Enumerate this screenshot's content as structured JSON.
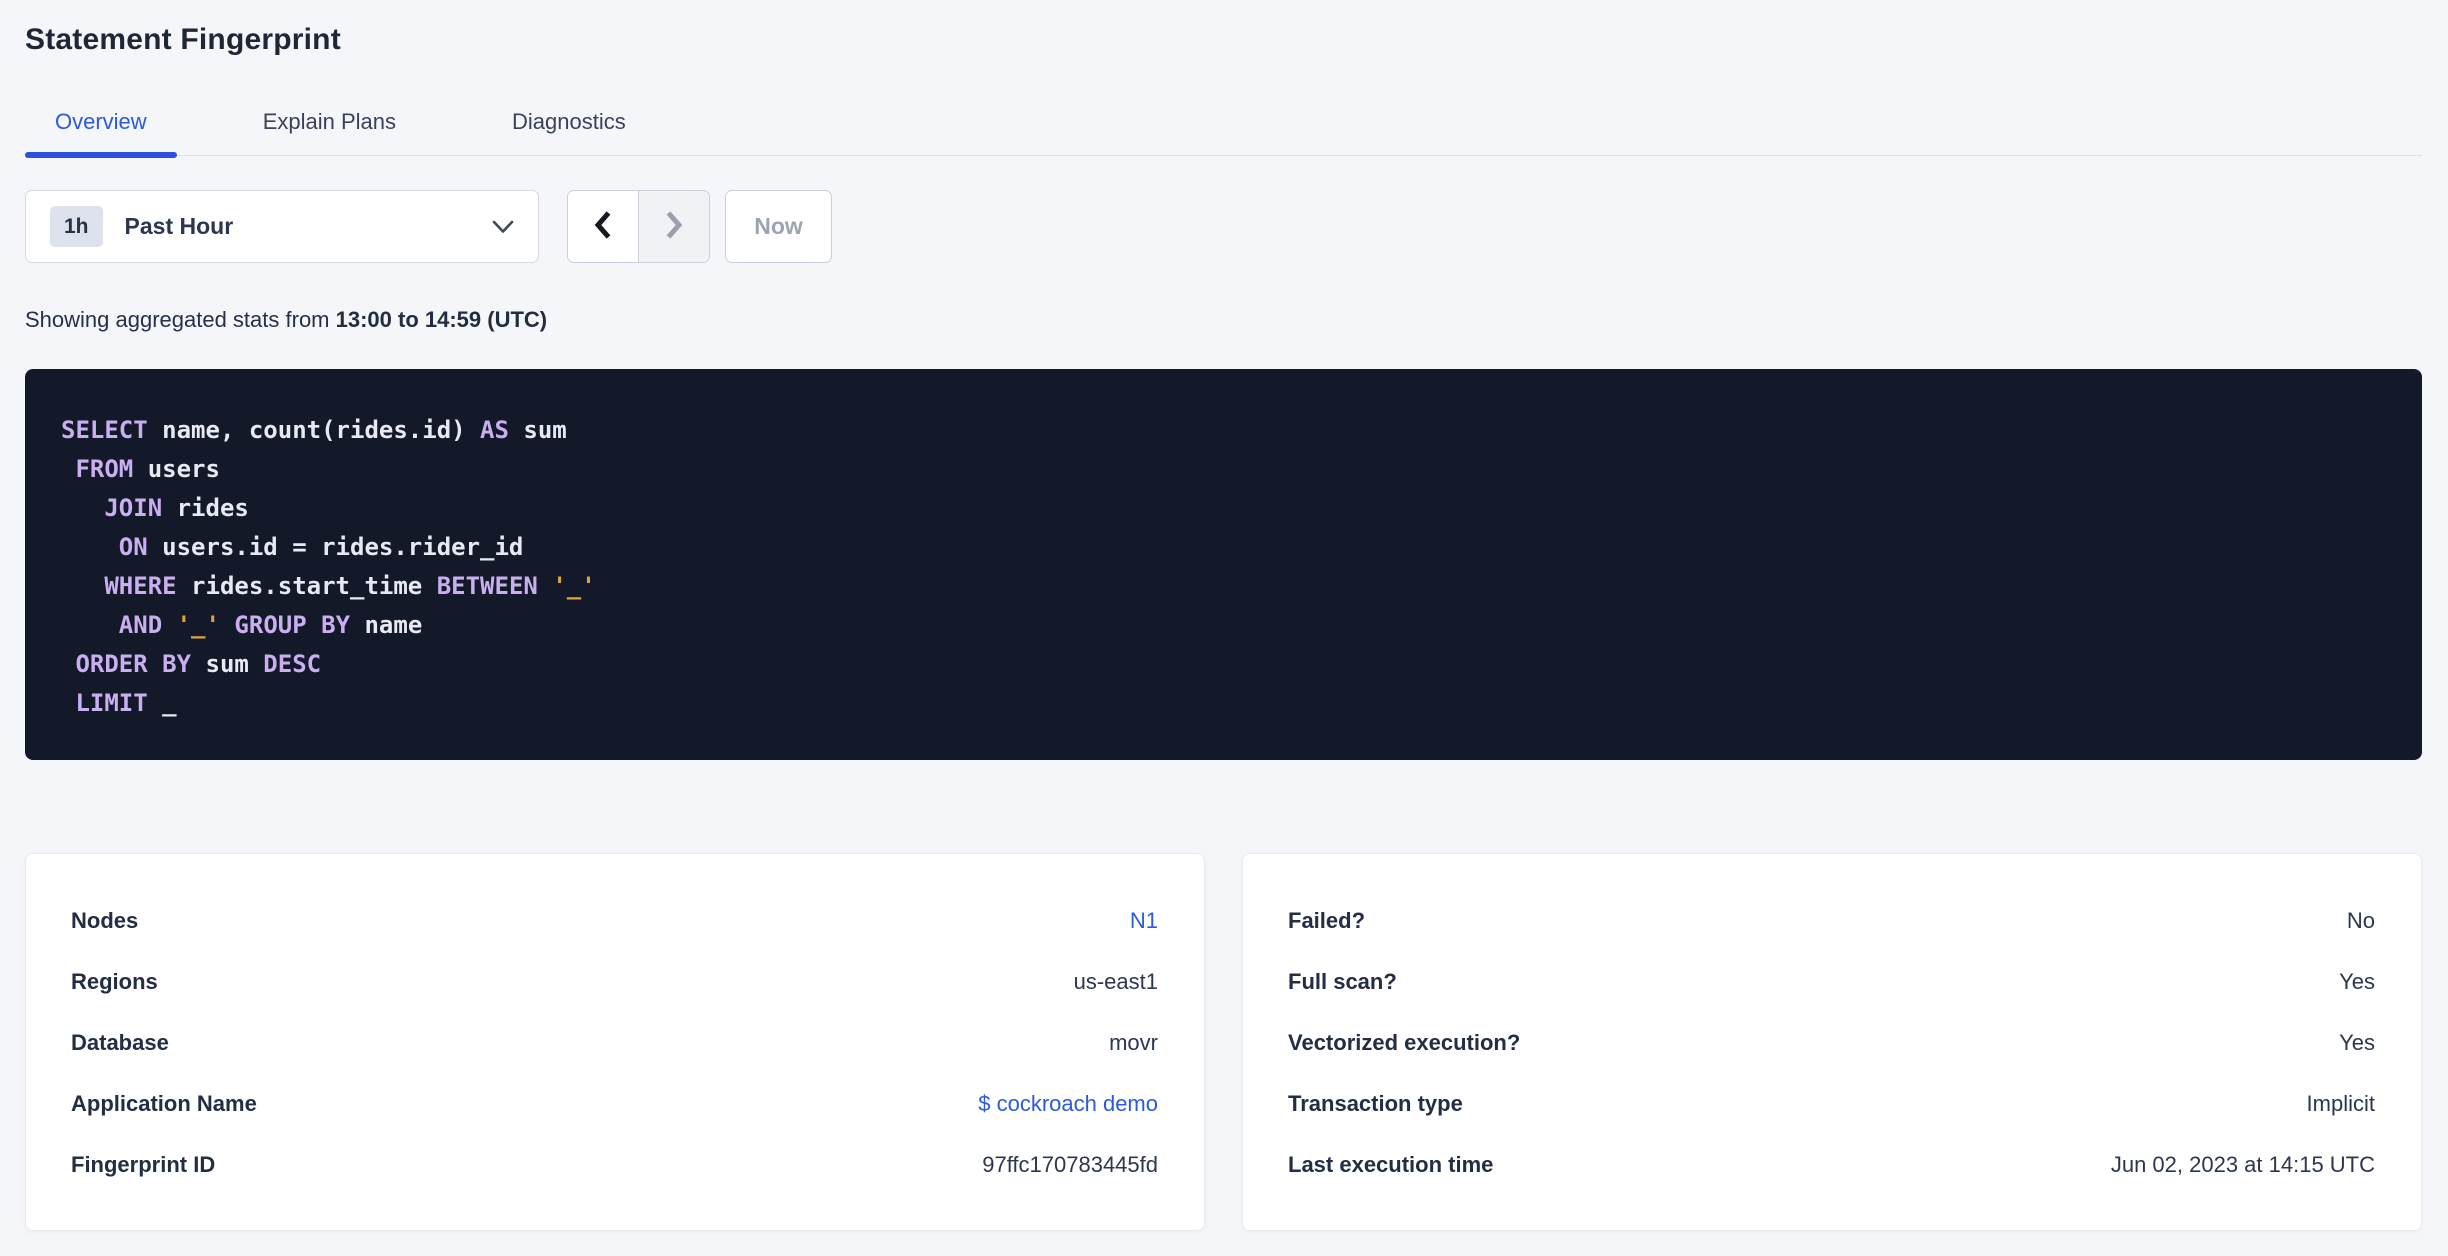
{
  "page": {
    "title": "Statement Fingerprint"
  },
  "tabs": [
    {
      "label": "Overview",
      "active": true
    },
    {
      "label": "Explain Plans",
      "active": false
    },
    {
      "label": "Diagnostics",
      "active": false
    }
  ],
  "time_picker": {
    "badge": "1h",
    "label": "Past Hour",
    "caret_icon": "chevron-down-icon"
  },
  "range_controls": {
    "prev_icon": "chevron-left-icon",
    "next_icon": "chevron-right-icon",
    "now_label": "Now"
  },
  "stats_line": {
    "prefix": "Showing aggregated stats from ",
    "bold_range": "13:00 to 14:59 (UTC)"
  },
  "sql": {
    "lines": [
      [
        [
          "kw",
          "SELECT"
        ],
        [
          "id",
          " name, count(rides.id) "
        ],
        [
          "kw",
          "AS"
        ],
        [
          "id",
          " sum"
        ]
      ],
      [
        [
          "id",
          " "
        ],
        [
          "kw",
          "FROM"
        ],
        [
          "id",
          " users"
        ]
      ],
      [
        [
          "id",
          "   "
        ],
        [
          "kw",
          "JOIN"
        ],
        [
          "id",
          " rides"
        ]
      ],
      [
        [
          "id",
          "    "
        ],
        [
          "kw",
          "ON"
        ],
        [
          "id",
          " users.id = rides.rider_id"
        ]
      ],
      [
        [
          "id",
          "   "
        ],
        [
          "kw",
          "WHERE"
        ],
        [
          "id",
          " rides.start_time "
        ],
        [
          "kw",
          "BETWEEN"
        ],
        [
          "id",
          " "
        ],
        [
          "str",
          "'_'"
        ]
      ],
      [
        [
          "id",
          "    "
        ],
        [
          "kw",
          "AND"
        ],
        [
          "id",
          " "
        ],
        [
          "str",
          "'_'"
        ],
        [
          "id",
          " "
        ],
        [
          "kw",
          "GROUP BY"
        ],
        [
          "id",
          " name"
        ]
      ],
      [
        [
          "id",
          " "
        ],
        [
          "kw",
          "ORDER BY"
        ],
        [
          "id",
          " sum "
        ],
        [
          "kw",
          "DESC"
        ]
      ],
      [
        [
          "id",
          " "
        ],
        [
          "kw",
          "LIMIT"
        ],
        [
          "id",
          " _"
        ]
      ]
    ]
  },
  "cards": [
    {
      "name": "statement-details",
      "rows": [
        {
          "name": "nodes",
          "label": "Nodes",
          "value": "N1",
          "link": true
        },
        {
          "name": "regions",
          "label": "Regions",
          "value": "us-east1",
          "link": false
        },
        {
          "name": "database",
          "label": "Database",
          "value": "movr",
          "link": false
        },
        {
          "name": "application-name",
          "label": "Application Name",
          "value": "$ cockroach demo",
          "link": true
        },
        {
          "name": "fingerprint-id",
          "label": "Fingerprint ID",
          "value": "97ffc170783445fd",
          "link": false
        }
      ]
    },
    {
      "name": "execution-attributes",
      "rows": [
        {
          "name": "failed",
          "label": "Failed?",
          "value": "No",
          "link": false
        },
        {
          "name": "full-scan",
          "label": "Full scan?",
          "value": "Yes",
          "link": false
        },
        {
          "name": "vectorized-execution",
          "label": "Vectorized execution?",
          "value": "Yes",
          "link": false
        },
        {
          "name": "transaction-type",
          "label": "Transaction type",
          "value": "Implicit",
          "link": false
        },
        {
          "name": "last-execution-time",
          "label": "Last execution time",
          "value": "Jun 02, 2023 at 14:15 UTC",
          "link": false
        }
      ]
    }
  ],
  "colors": {
    "page_bg": "#f5f6fa",
    "accent_blue": "#2b59e0",
    "link_blue": "#2b5ae2",
    "sql_bg": "#131929",
    "sql_keyword": "#c9aef0",
    "sql_identifier": "#e9e9f4",
    "sql_string": "#e2a23e"
  }
}
